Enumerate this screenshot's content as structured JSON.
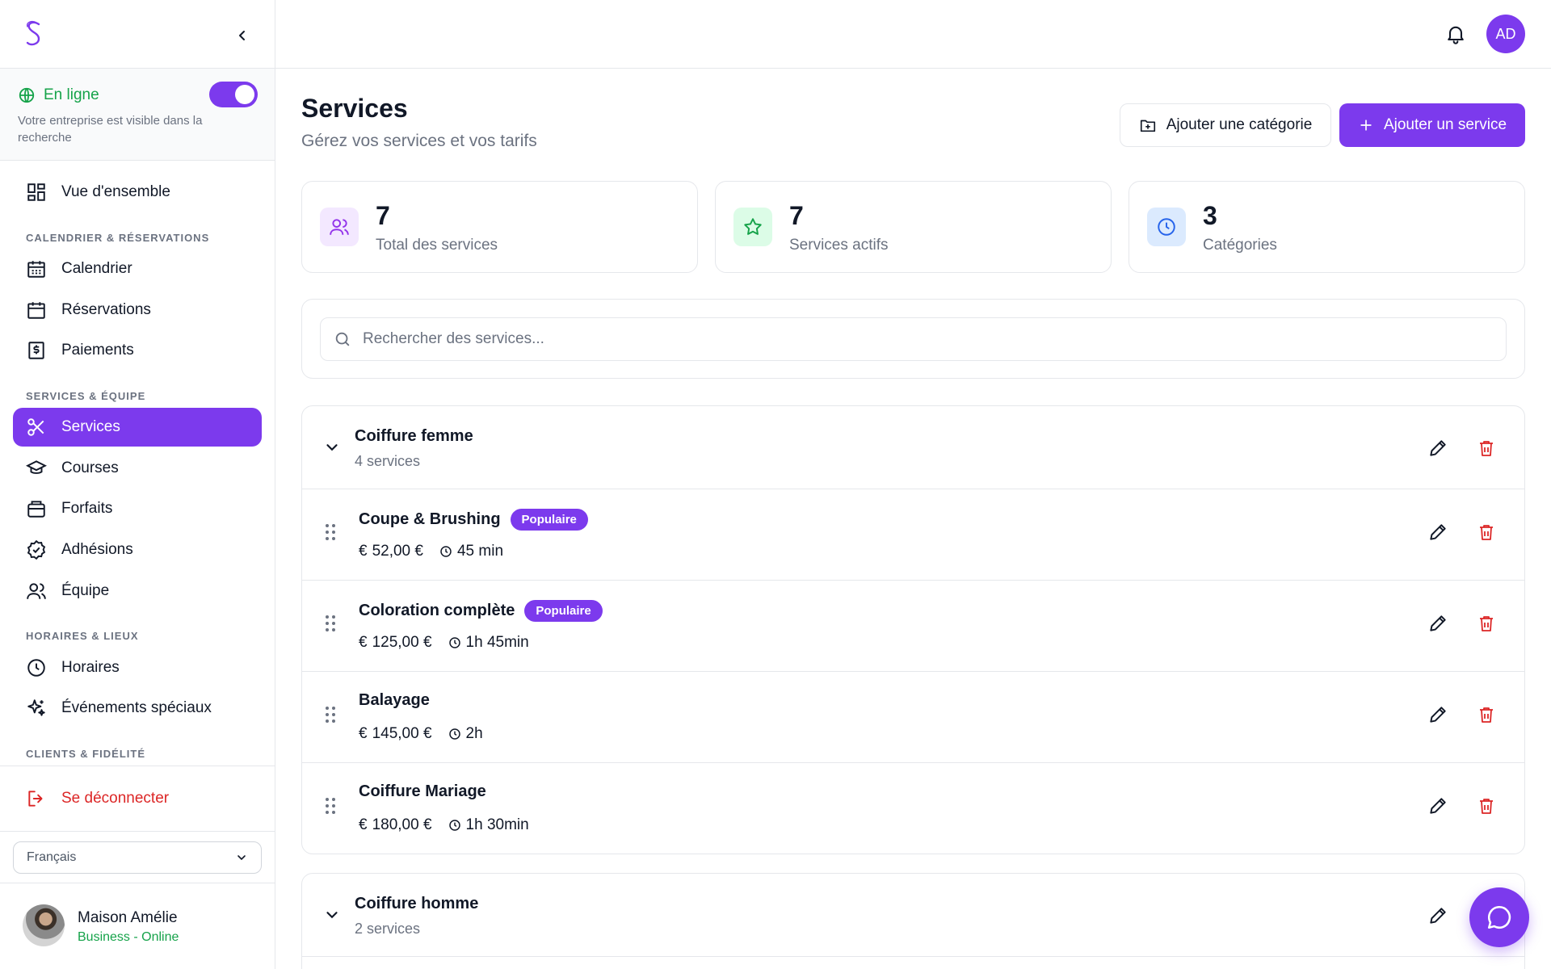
{
  "sidebar": {
    "online": {
      "label": "En ligne",
      "description": "Votre entreprise est visible dans la recherche",
      "enabled": true
    },
    "overview": "Vue d'ensemble",
    "sections": {
      "calendar": "CALENDRIER & RÉSERVATIONS",
      "services": "SERVICES & ÉQUIPE",
      "hours": "HORAIRES & LIEUX",
      "clients": "CLIENTS & FIDÉLITÉ"
    },
    "items": {
      "calendrier": "Calendrier",
      "reservations": "Réservations",
      "paiements": "Paiements",
      "services": "Services",
      "courses": "Courses",
      "forfaits": "Forfaits",
      "adhesions": "Adhésions",
      "equipe": "Équipe",
      "horaires": "Horaires",
      "evenements": "Événements spéciaux"
    },
    "logout": "Se déconnecter",
    "language": "Français",
    "user": {
      "name": "Maison Amélie",
      "plan": "Business - Online"
    }
  },
  "header": {
    "avatar_initials": "AD"
  },
  "page": {
    "title": "Services",
    "subtitle": "Gérez vos services et vos tarifs",
    "add_category": "Ajouter une catégorie",
    "add_service": "Ajouter un service"
  },
  "stats": [
    {
      "value": "7",
      "label": "Total des services",
      "icon": "users-icon",
      "color": "#9333ea",
      "bg": "#f3e8ff"
    },
    {
      "value": "7",
      "label": "Services actifs",
      "icon": "star-icon",
      "color": "#16a34a",
      "bg": "#dcfce7"
    },
    {
      "value": "3",
      "label": "Catégories",
      "icon": "clock-icon",
      "color": "#2563eb",
      "bg": "#dbeafe"
    }
  ],
  "search": {
    "placeholder": "Rechercher des services..."
  },
  "categories": [
    {
      "name": "Coiffure femme",
      "count": "4 services",
      "services": [
        {
          "name": "Coupe & Brushing",
          "badge": "Populaire",
          "price": "52,00 €",
          "duration": "45 min"
        },
        {
          "name": "Coloration complète",
          "badge": "Populaire",
          "price": "125,00 €",
          "duration": "1h 45min"
        },
        {
          "name": "Balayage",
          "badge": "",
          "price": "145,00 €",
          "duration": "2h"
        },
        {
          "name": "Coiffure Mariage",
          "badge": "",
          "price": "180,00 €",
          "duration": "1h 30min"
        }
      ]
    },
    {
      "name": "Coiffure homme",
      "count": "2 services"
    }
  ],
  "currency_symbol": "€",
  "colors": {
    "accent": "#7c3aed",
    "danger": "#dc2626",
    "success": "#16a34a"
  }
}
